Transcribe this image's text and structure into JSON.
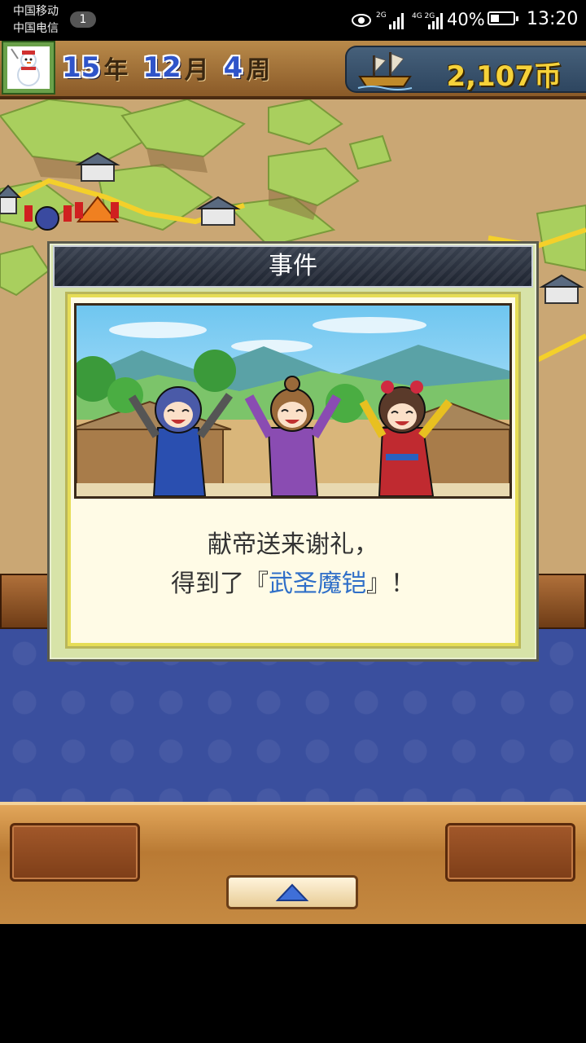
{
  "status_bar": {
    "carrier_1": "中国移动",
    "carrier_2": "中国电信",
    "notification_count": "1",
    "signal_1_label": "2G",
    "signal_2_label": "4G 2G",
    "battery_percent": "40%",
    "battery_level": 0.4,
    "time": "13:20"
  },
  "top_bar": {
    "year": "15",
    "year_unit": "年",
    "month": "12",
    "month_unit": "月",
    "week": "4",
    "week_unit": "周",
    "money": "2,107币",
    "avatar_icon": "snowman-icon",
    "ship_icon": "ship-icon"
  },
  "dialog": {
    "title": "事件",
    "message_line_1": "献帝送来谢礼，",
    "message_line_2_prefix": "得到了『",
    "message_item": "武圣魔铠",
    "message_line_2_suffix": "』！",
    "item_color": "#2f6fc8"
  },
  "console": {
    "up_icon": "triangle-up-icon"
  }
}
